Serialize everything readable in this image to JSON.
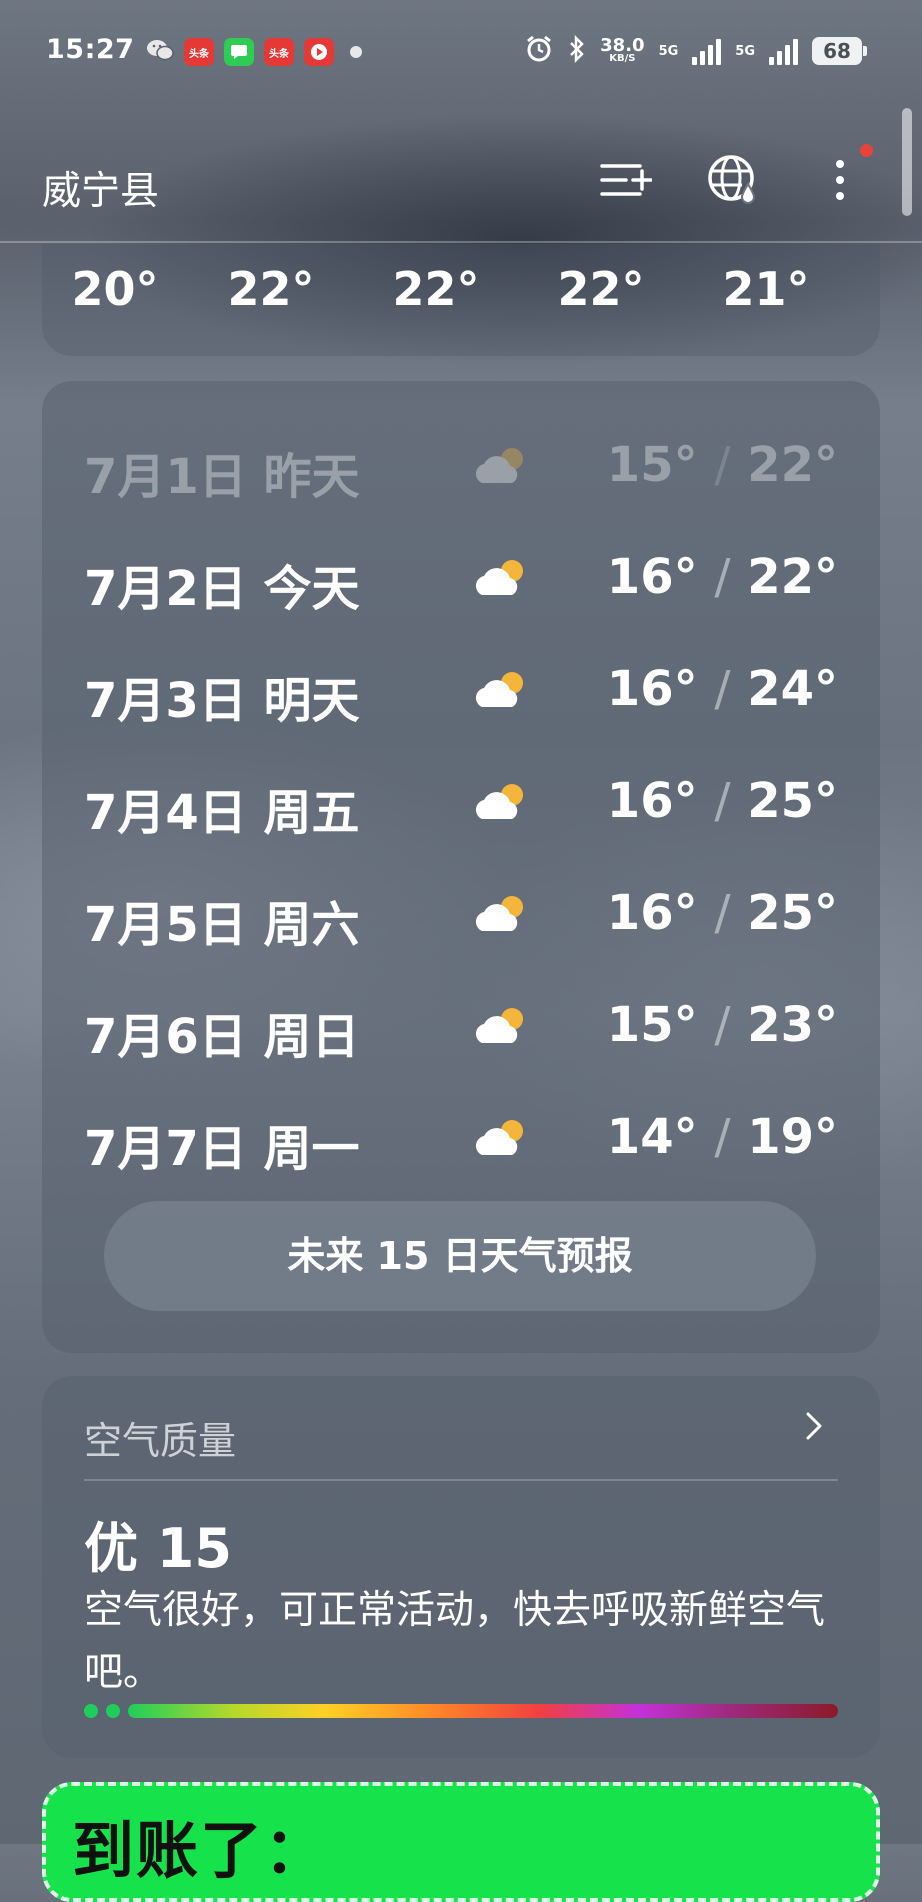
{
  "status_bar": {
    "time": "15:27",
    "apps": [
      {
        "icon": "wechat-icon",
        "label": ""
      },
      {
        "icon": "toutiao-icon",
        "label": "头条",
        "color": "#e53935"
      },
      {
        "icon": "messages-icon",
        "label": "",
        "color": "#2ecc52"
      },
      {
        "icon": "toutiao-lite-icon",
        "label": "头条",
        "color": "#e53935"
      },
      {
        "icon": "video-app-icon",
        "label": "",
        "color": "#e53935"
      }
    ],
    "net_speed": "38.0",
    "net_unit": "KB/S",
    "signal_label_1": "5G",
    "signal_label_2": "5G",
    "battery": "68"
  },
  "header": {
    "city": "威宁县",
    "add_city_icon": "add-city-icon",
    "globe_icon": "globe-weather-icon",
    "more_icon": "more-vertical-icon",
    "notification_dot_color": "#e9423a"
  },
  "hourly": {
    "temps": [
      "20°",
      "22°",
      "22°",
      "22°",
      "21°"
    ]
  },
  "forecast": {
    "rows": [
      {
        "date": "7月1日",
        "day": "昨天",
        "icon": "partly-cloudy-icon",
        "low": "15°",
        "high": "22°",
        "past": true
      },
      {
        "date": "7月2日",
        "day": "今天",
        "icon": "partly-cloudy-icon",
        "low": "16°",
        "high": "22°",
        "past": false
      },
      {
        "date": "7月3日",
        "day": "明天",
        "icon": "partly-cloudy-icon",
        "low": "16°",
        "high": "24°",
        "past": false
      },
      {
        "date": "7月4日",
        "day": "周五",
        "icon": "partly-cloudy-icon",
        "low": "16°",
        "high": "25°",
        "past": false
      },
      {
        "date": "7月5日",
        "day": "周六",
        "icon": "partly-cloudy-icon",
        "low": "16°",
        "high": "25°",
        "past": false
      },
      {
        "date": "7月6日",
        "day": "周日",
        "icon": "partly-cloudy-icon",
        "low": "15°",
        "high": "23°",
        "past": false
      },
      {
        "date": "7月7日",
        "day": "周一",
        "icon": "partly-cloudy-icon",
        "low": "14°",
        "high": "19°",
        "past": false
      }
    ],
    "button_label": "未来 15 日天气预报"
  },
  "air_quality": {
    "title": "空气质量",
    "value": "优 15",
    "description": "空气很好，可正常活动，快去呼吸新鲜空气吧。",
    "scale_colors": [
      "#1fce5a",
      "#ffcf26",
      "#ff8c26",
      "#f04040",
      "#c431d8",
      "#8b1a2a"
    ]
  },
  "promo": {
    "text": "到账了："
  }
}
